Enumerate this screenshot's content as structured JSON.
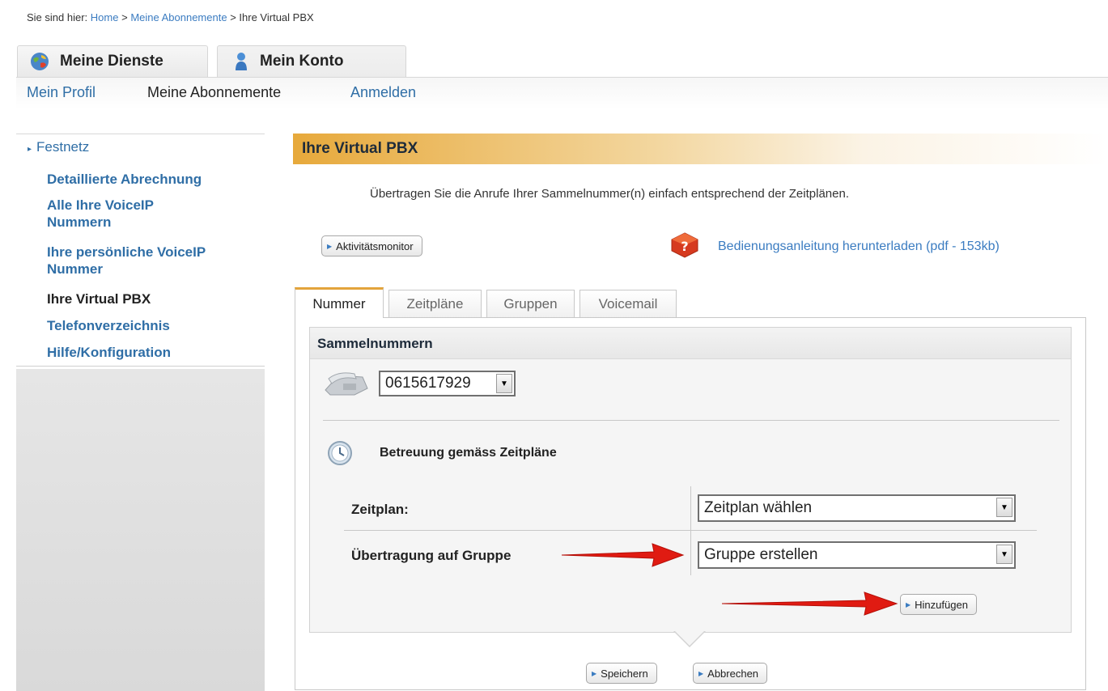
{
  "breadcrumb": {
    "prefix": "Sie sind hier:",
    "items": [
      "Home",
      ">",
      "Meine Abonnemente",
      ">",
      "Ihre Virtual PBX"
    ]
  },
  "top_tabs": [
    {
      "label": "Meine Dienste",
      "icon": "globe-icon"
    },
    {
      "label": "Mein Konto",
      "icon": "user-icon"
    }
  ],
  "subnav": [
    "Mein Profil",
    "Meine Abonnemente",
    "Anmelden"
  ],
  "sidebar": {
    "section": "Festnetz",
    "items": [
      {
        "label": "Detaillierte Abrechnung"
      },
      {
        "label": "Alle Ihre VoiceIP Nummern"
      },
      {
        "label": "Ihre persönliche VoiceIP Nummer"
      },
      {
        "label": "Ihre Virtual PBX",
        "current": true
      },
      {
        "label": "Telefonverzeichnis"
      },
      {
        "label": "Hilfe/Konfiguration"
      }
    ]
  },
  "main": {
    "title": "Ihre Virtual PBX",
    "intro": "Übertragen Sie die Anrufe Ihrer Sammelnummer(n) einfach entsprechend der Zeitplänen.",
    "activity_button": "Aktivitätsmonitor",
    "manual_link": "Bedienungsanleitung herunterladen (pdf - 153kb)",
    "tabs": [
      "Nummer",
      "Zeitpläne",
      "Gruppen",
      "Voicemail"
    ],
    "active_tab": "Nummer",
    "panel": {
      "title": "Sammelnummern",
      "number_select": "0615617929",
      "schedule_heading": "Betreuung gemäss Zeitpläne",
      "zeitplan_label": "Zeitplan:",
      "zeitplan_select": "Zeitplan wählen",
      "gruppe_label": "Übertragung auf Gruppe",
      "gruppe_select": "Gruppe erstellen",
      "add_button": "Hinzufügen"
    },
    "save_button": "Speichern",
    "cancel_button": "Abbrechen"
  },
  "colors": {
    "link": "#2f6ea6",
    "header_gradient_start": "#e7a93b",
    "active_tab_border": "#e3a43b",
    "arrow_red": "#e01b12"
  }
}
